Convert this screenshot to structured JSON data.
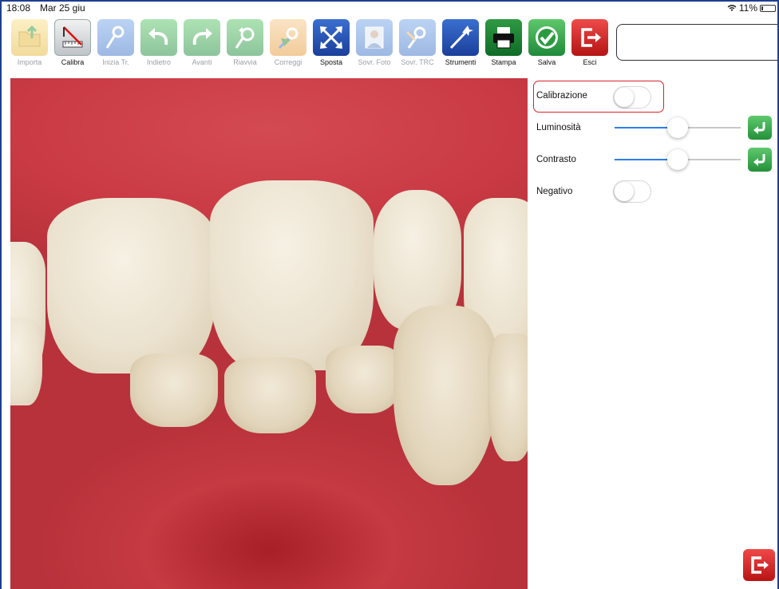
{
  "status": {
    "time": "18:08",
    "date": "Mar 25 giu",
    "battery": "11%"
  },
  "toolbar": [
    {
      "label": "Importa",
      "icon": "import-folder-icon",
      "enabled": false
    },
    {
      "label": "Calibra",
      "icon": "calibrate-ruler-icon",
      "enabled": true
    },
    {
      "label": "Inizia Tr.",
      "icon": "start-trace-icon",
      "enabled": false
    },
    {
      "label": "Indietro",
      "icon": "undo-icon",
      "enabled": false
    },
    {
      "label": "Avanti",
      "icon": "redo-icon",
      "enabled": false
    },
    {
      "label": "Riavvia",
      "icon": "restart-icon",
      "enabled": false
    },
    {
      "label": "Correggi",
      "icon": "correct-icon",
      "enabled": false
    },
    {
      "label": "Sposta",
      "icon": "move-arrows-icon",
      "enabled": true
    },
    {
      "label": "Sovr. Foto",
      "icon": "overlay-photo-icon",
      "enabled": false
    },
    {
      "label": "Sovr. TRC",
      "icon": "overlay-trace-icon",
      "enabled": false
    },
    {
      "label": "Strumenti",
      "icon": "tools-wand-icon",
      "enabled": true
    },
    {
      "label": "Stampa",
      "icon": "print-icon",
      "enabled": true
    },
    {
      "label": "Salva",
      "icon": "save-check-icon",
      "enabled": true
    },
    {
      "label": "Esci",
      "icon": "exit-icon",
      "enabled": true
    }
  ],
  "panel": {
    "calibration": {
      "label": "Calibrazione",
      "on": false
    },
    "brightness": {
      "label": "Luminosità",
      "value": 0.5
    },
    "contrast": {
      "label": "Contrasto",
      "value": 0.5
    },
    "negative": {
      "label": "Negativo",
      "on": false
    }
  },
  "colors": {
    "accent": "#2f7ee8",
    "highlight": "#d8232a",
    "frame": "#1f3f8f"
  }
}
